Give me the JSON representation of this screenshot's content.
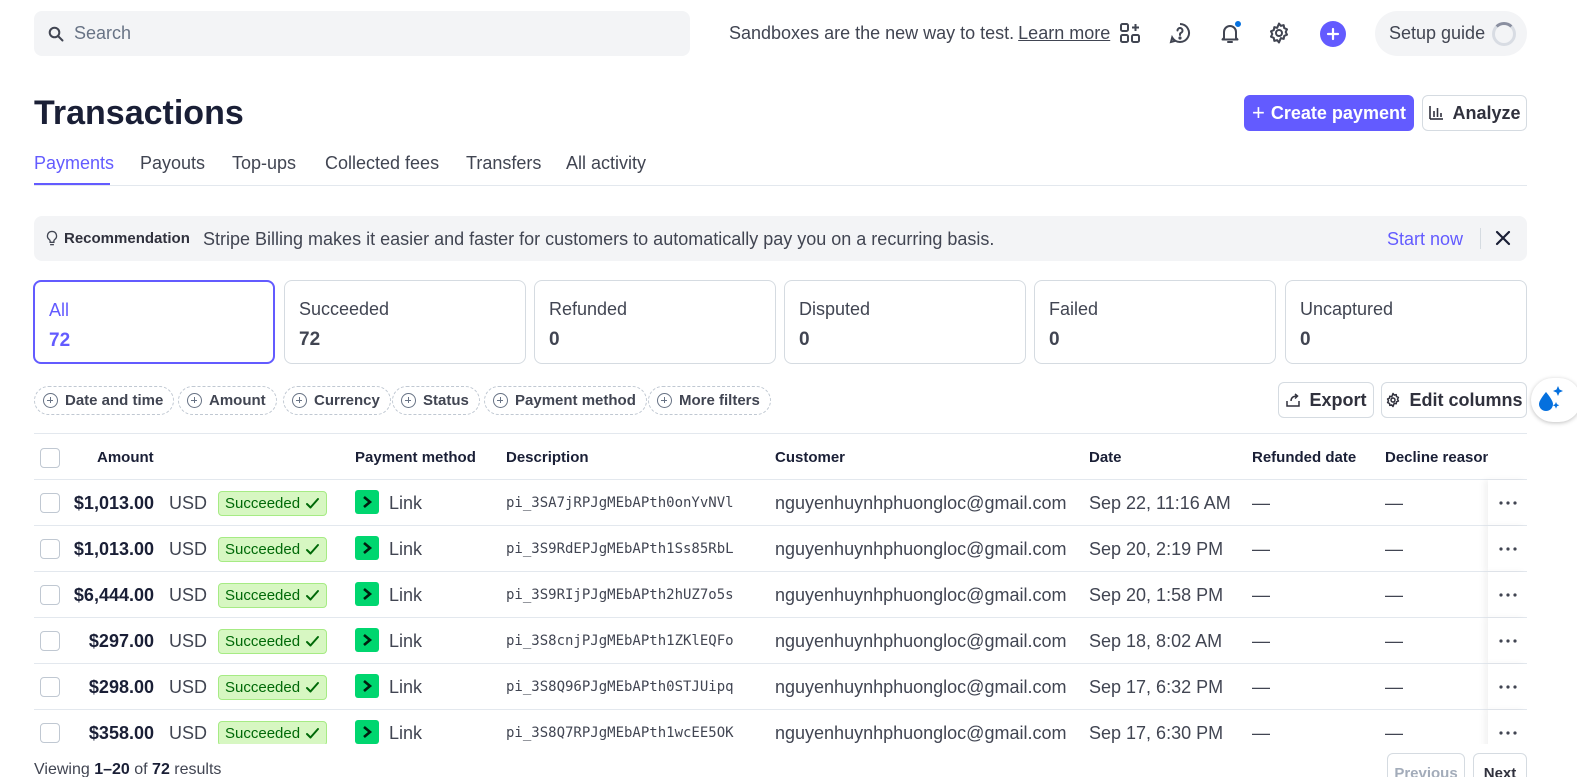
{
  "search": {
    "placeholder": "Search"
  },
  "topbar": {
    "sandbox_message": "Sandboxes are the new way to test.",
    "learn_more": "Learn more",
    "setup_guide": "Setup guide"
  },
  "header": {
    "title": "Transactions",
    "create_payment": "Create payment",
    "analyze": "Analyze"
  },
  "tabs": [
    {
      "label": "Payments",
      "active": true
    },
    {
      "label": "Payouts"
    },
    {
      "label": "Top-ups"
    },
    {
      "label": "Collected fees"
    },
    {
      "label": "Transfers"
    },
    {
      "label": "All activity"
    }
  ],
  "recommendation": {
    "label": "Recommendation",
    "message": "Stripe Billing makes it easier and faster for customers to automatically pay you on a recurring basis.",
    "action": "Start now"
  },
  "status_filters": [
    {
      "label": "All",
      "count": "72",
      "active": true
    },
    {
      "label": "Succeeded",
      "count": "72"
    },
    {
      "label": "Refunded",
      "count": "0"
    },
    {
      "label": "Disputed",
      "count": "0"
    },
    {
      "label": "Failed",
      "count": "0"
    },
    {
      "label": "Uncaptured",
      "count": "0"
    }
  ],
  "filters": [
    "Date and time",
    "Amount",
    "Currency",
    "Status",
    "Payment method",
    "More filters"
  ],
  "toolbar": {
    "export": "Export",
    "edit_columns": "Edit columns"
  },
  "table": {
    "headers": {
      "amount": "Amount",
      "payment_method": "Payment method",
      "description": "Description",
      "customer": "Customer",
      "date": "Date",
      "refunded_date": "Refunded date",
      "decline_reason": "Decline reason"
    },
    "rows": [
      {
        "amount": "$1,013.00",
        "currency": "USD",
        "status": "Succeeded",
        "method": "Link",
        "description": "pi_3SA7jRPJgMEbAPth0onYvNVl",
        "customer": "nguyenhuynhphuongloc@gmail.com",
        "date": "Sep 22, 11:16 AM",
        "refunded_date": "—",
        "decline_reason": "—"
      },
      {
        "amount": "$1,013.00",
        "currency": "USD",
        "status": "Succeeded",
        "method": "Link",
        "description": "pi_3S9RdEPJgMEbAPth1Ss85RbL",
        "customer": "nguyenhuynhphuongloc@gmail.com",
        "date": "Sep 20, 2:19 PM",
        "refunded_date": "—",
        "decline_reason": "—"
      },
      {
        "amount": "$6,444.00",
        "currency": "USD",
        "status": "Succeeded",
        "method": "Link",
        "description": "pi_3S9RIjPJgMEbAPth2hUZ7o5s",
        "customer": "nguyenhuynhphuongloc@gmail.com",
        "date": "Sep 20, 1:58 PM",
        "refunded_date": "—",
        "decline_reason": "—"
      },
      {
        "amount": "$297.00",
        "currency": "USD",
        "status": "Succeeded",
        "method": "Link",
        "description": "pi_3S8cnjPJgMEbAPth1ZKlEQFo",
        "customer": "nguyenhuynhphuongloc@gmail.com",
        "date": "Sep 18, 8:02 AM",
        "refunded_date": "—",
        "decline_reason": "—"
      },
      {
        "amount": "$298.00",
        "currency": "USD",
        "status": "Succeeded",
        "method": "Link",
        "description": "pi_3S8Q96PJgMEbAPth0STJUipq",
        "customer": "nguyenhuynhphuongloc@gmail.com",
        "date": "Sep 17, 6:32 PM",
        "refunded_date": "—",
        "decline_reason": "—"
      },
      {
        "amount": "$358.00",
        "currency": "USD",
        "status": "Succeeded",
        "method": "Link",
        "description": "pi_3S8Q7RPJgMEbAPth1wcEE5OK",
        "customer": "nguyenhuynhphuongloc@gmail.com",
        "date": "Sep 17, 6:30 PM",
        "refunded_date": "—",
        "decline_reason": "—"
      }
    ]
  },
  "pagination": {
    "viewing": "Viewing",
    "range": "1–20",
    "of": "of",
    "total": "72",
    "results": "results",
    "previous": "Previous",
    "next": "Next"
  },
  "colors": {
    "accent": "#635bff",
    "success_bg": "#d7f7c2",
    "success_text": "#006908",
    "link_brand": "#00d66f"
  },
  "icons": [
    "search-icon",
    "apps-icon",
    "help-icon",
    "bell-icon",
    "gear-icon",
    "plus-icon",
    "lightbulb-icon",
    "close-icon",
    "export-icon",
    "chart-icon",
    "check-icon",
    "more-icon"
  ]
}
